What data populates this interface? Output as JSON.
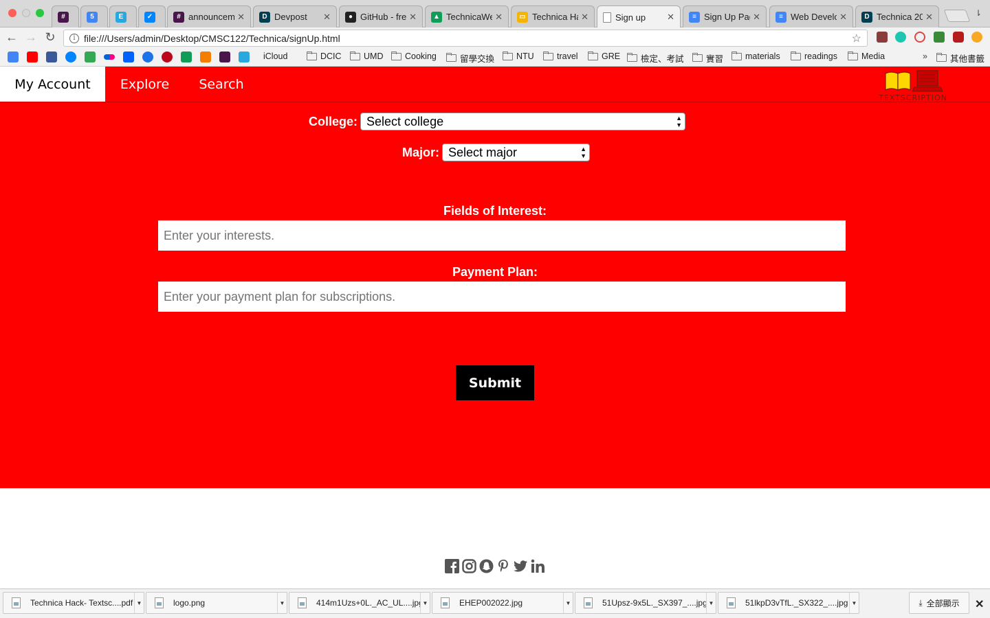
{
  "browser": {
    "tabs": [
      {
        "label": "",
        "icon": "slack-hash-icon",
        "color": "#4a154b",
        "glyph": "#"
      },
      {
        "label": "",
        "icon": "calendar-icon",
        "color": "#4285f4",
        "glyph": "5"
      },
      {
        "label": "",
        "icon": "elevated-icon",
        "color": "#29a8e0",
        "glyph": "E"
      },
      {
        "label": "",
        "icon": "messenger-icon",
        "color": "#0084ff",
        "glyph": "✓"
      },
      {
        "label": "announceme",
        "icon": "slack-hash-icon",
        "color": "#4a154b",
        "glyph": "#"
      },
      {
        "label": "Devpost",
        "icon": "devpost-icon",
        "color": "#003e54",
        "glyph": "D"
      },
      {
        "label": "GitHub - fres",
        "icon": "github-icon",
        "color": "#222222",
        "glyph": "●"
      },
      {
        "label": "TechnicaWel",
        "icon": "google-drive-icon",
        "color": "#0f9d58",
        "glyph": "▲"
      },
      {
        "label": "Technica Ha",
        "icon": "google-slides-icon",
        "color": "#f4b400",
        "glyph": "▭"
      },
      {
        "label": "Sign up",
        "icon": "page-icon",
        "color": "#ffffff",
        "glyph": ""
      },
      {
        "label": "Sign Up Pag",
        "icon": "google-docs-icon",
        "color": "#4285f4",
        "glyph": "≡"
      },
      {
        "label": "Web Develop",
        "icon": "google-docs-icon",
        "color": "#4285f4",
        "glyph": "≡"
      },
      {
        "label": "Technica 20",
        "icon": "devpost-icon",
        "color": "#003e54",
        "glyph": "D"
      }
    ],
    "active_tab": 9,
    "url": "file:///Users/admin/Desktop/CMSC122/Technica/signUp.html",
    "bookmarks": [
      "iCloud",
      "DCIC",
      "UMD",
      "Cooking",
      "留學交換",
      "NTU",
      "travel",
      "GRE",
      "檢定、考試",
      "實習",
      "materials",
      "readings",
      "Media"
    ],
    "other_bookmarks": "其他書籤",
    "overflow": "»"
  },
  "nav": {
    "items": [
      "My Account",
      "Explore",
      "Search"
    ],
    "logo_text": "TEXTSCRIPTION"
  },
  "form": {
    "college_label": "College:",
    "college_value": "Select college",
    "major_label": "Major:",
    "major_value": "Select major",
    "interests_label": "Fields of Interest:",
    "interests_placeholder": "Enter your interests.",
    "payment_label": "Payment Plan:",
    "payment_placeholder": "Enter your payment plan for subscriptions.",
    "submit_label": "Submit"
  },
  "footer": {
    "social": [
      "facebook-icon",
      "instagram-icon",
      "snapchat-icon",
      "pinterest-icon",
      "twitter-icon",
      "linkedin-icon"
    ]
  },
  "downloads": {
    "files": [
      "Technica Hack- Textsc....pdf",
      "logo.png",
      "414m1Uzs+0L._AC_UL....jpg",
      "EHEP002022.jpg",
      "51Upsz-9x5L._SX397_....jpg",
      "51lkpD3vTfL._SX322_....jpg"
    ],
    "show_all": "全部顯示"
  },
  "colors": {
    "brand_red": "#ff0000",
    "submit_bg": "#000000"
  }
}
